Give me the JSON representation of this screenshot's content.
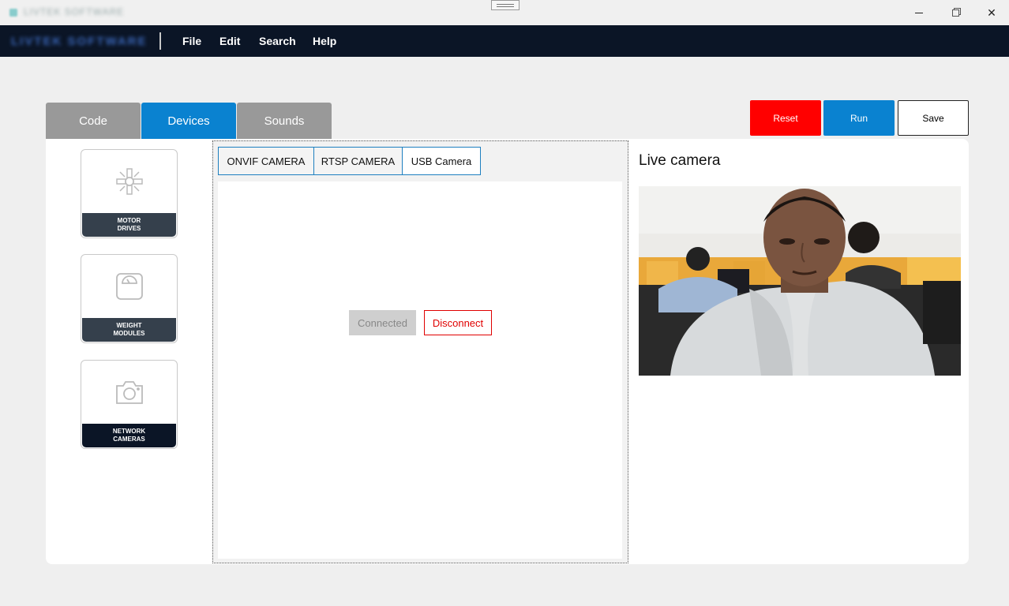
{
  "window": {
    "title": "LIVTEK SOFTWARE",
    "minimize_icon": "minimize-icon",
    "maximize_icon": "restore-icon",
    "close_glyph": "✕"
  },
  "menubar": {
    "logo": "LIVTEK SOFTWARE",
    "items": [
      "File",
      "Edit",
      "Search",
      "Help"
    ]
  },
  "tabs": [
    {
      "label": "Code",
      "active": false
    },
    {
      "label": "Devices",
      "active": true
    },
    {
      "label": "Sounds",
      "active": false
    }
  ],
  "actions": {
    "reset": "Reset",
    "run": "Run",
    "save": "Save"
  },
  "devices": [
    {
      "label": "MOTOR\nDRIVES",
      "icon": "motor-drive-icon",
      "active": false
    },
    {
      "label": "WEIGHT\nMODULES",
      "icon": "weighing-scale-icon",
      "active": false
    },
    {
      "label": "NETWORK\nCAMERAS",
      "icon": "camera-icon",
      "active": true
    }
  ],
  "camera_tabs": [
    {
      "label": "ONVIF CAMERA",
      "active": false
    },
    {
      "label": "RTSP CAMERA",
      "active": false
    },
    {
      "label": "USB Camera",
      "active": true
    }
  ],
  "connection": {
    "connected": "Connected",
    "disconnect": "Disconnect"
  },
  "live": {
    "title": "Live camera"
  },
  "colors": {
    "menubar_bg": "#0b1526",
    "accent": "#0a82d0",
    "reset": "#ff0000",
    "disconnect": "#e00000"
  }
}
